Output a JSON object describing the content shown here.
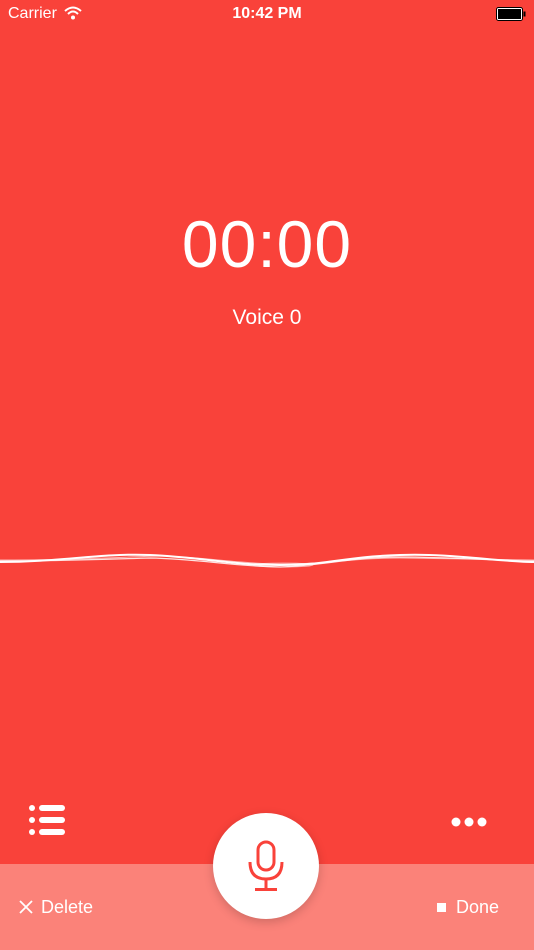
{
  "status_bar": {
    "carrier": "Carrier",
    "time": "10:42 PM"
  },
  "recorder": {
    "elapsed": "00:00",
    "title": "Voice 0"
  },
  "actions": {
    "delete_label": "Delete",
    "done_label": "Done"
  },
  "icons": {
    "list": "list-icon",
    "more": "more-icon",
    "microphone": "microphone-icon",
    "delete": "close-icon",
    "done": "stop-icon",
    "wifi": "wifi-icon",
    "battery": "battery-icon"
  },
  "colors": {
    "background": "#F9423A",
    "bottom_bar": "#FB8279",
    "accent": "#F9423A"
  }
}
